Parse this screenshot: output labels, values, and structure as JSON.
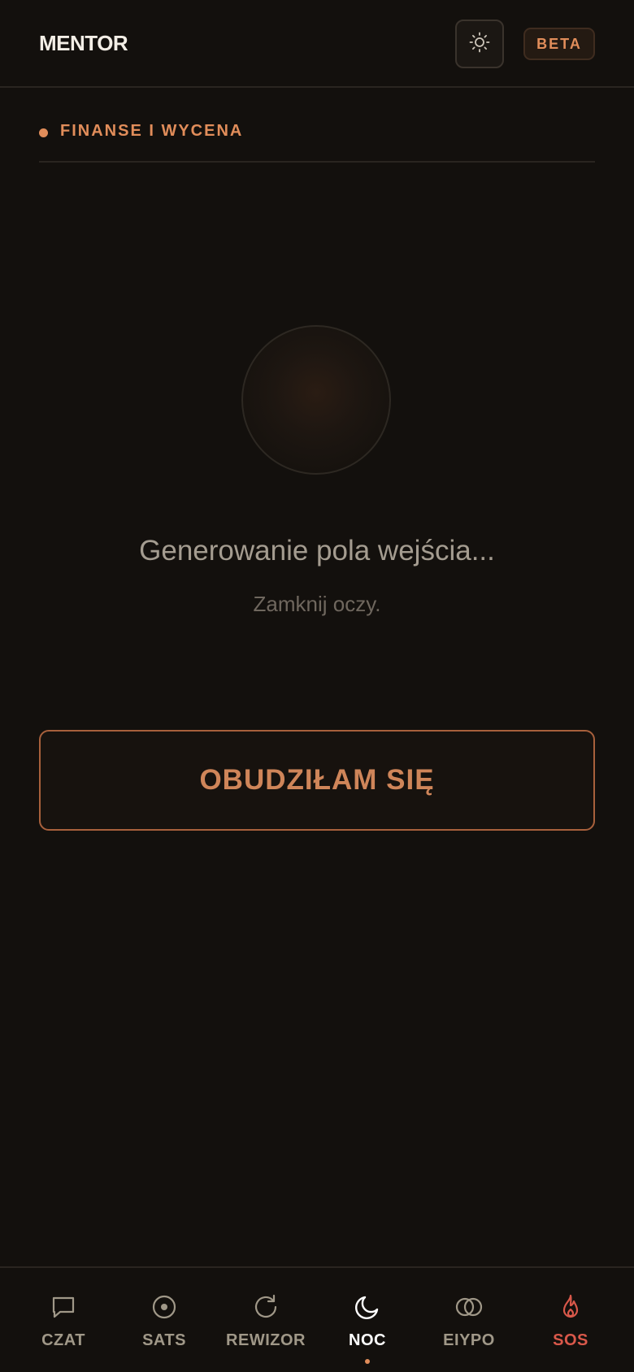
{
  "header": {
    "app_title": "MENTOR",
    "theme_toggle_icon": "sun-icon",
    "beta_badge": "BETA"
  },
  "section": {
    "label": "FINANSE I WYCENA"
  },
  "main": {
    "status_title": "Generowanie pola wejścia...",
    "status_subtitle": "Zamknij oczy.",
    "wake_button_label": "OBUDZIŁAM SIĘ"
  },
  "nav": {
    "items": [
      {
        "label": "CZAT",
        "icon": "chat-icon"
      },
      {
        "label": "SATS",
        "icon": "target-icon"
      },
      {
        "label": "REWIZOR",
        "icon": "refresh-icon"
      },
      {
        "label": "NOC",
        "icon": "moon-icon",
        "active": true
      },
      {
        "label": "EIYPO",
        "icon": "circles-icon"
      },
      {
        "label": "SOS",
        "icon": "flame-icon",
        "highlight": true
      }
    ]
  },
  "colors": {
    "background": "#13100d",
    "accent": "#e18d5a",
    "button_text": "#cf8559",
    "sos": "#d9584a"
  }
}
